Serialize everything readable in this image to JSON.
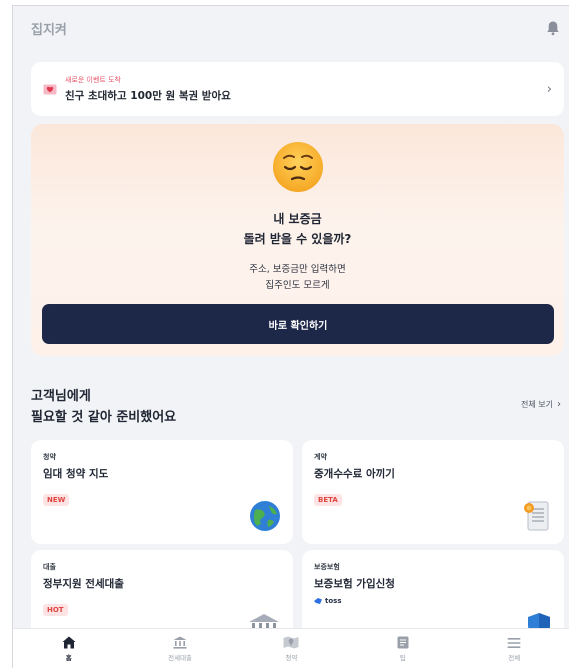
{
  "header": {
    "app_title": "집지켜",
    "icon": "bell-icon"
  },
  "event_banner": {
    "kicker": "새로운 이벤트 도착",
    "title": "친구 초대하고 100만 원 복권 받아요",
    "icon": "heart-envelope-icon"
  },
  "hero": {
    "title_line1": "내 보증금",
    "title_line2": "돌려 받을 수 있을까?",
    "sub_line1": "주소, 보증금만 입력하면",
    "sub_line2": "집주인도 모르게",
    "button_label": "바로 확인하기"
  },
  "recommend": {
    "title_line1": "고객님에게",
    "title_line2": "필요할 것 같아 준비했어요",
    "see_all_label": "전체 보기"
  },
  "cards": [
    {
      "category": "청약",
      "title": "임대 청약 지도",
      "badge": "NEW",
      "icon": "globe-icon"
    },
    {
      "category": "계약",
      "title": "중개수수료 아끼기",
      "badge": "BETA",
      "icon": "document-seal-icon"
    },
    {
      "category": "대출",
      "title": "정부지원 전세대출",
      "badge": "HOT",
      "icon": "bank-icon"
    },
    {
      "category": "보증보험",
      "title": "보증보험 가입신청",
      "badge": "toss",
      "icon": "shield-icon"
    }
  ],
  "tabbar": {
    "items": [
      {
        "label": "홈",
        "icon": "home-icon",
        "active": true
      },
      {
        "label": "전세대출",
        "icon": "bank-icon",
        "active": false
      },
      {
        "label": "청약",
        "icon": "map-icon",
        "active": false
      },
      {
        "label": "팁",
        "icon": "book-icon",
        "active": false
      },
      {
        "label": "전체",
        "icon": "menu-icon",
        "active": false
      }
    ]
  },
  "colors": {
    "accent_navy": "#1d2748",
    "badge_red": "#e0453f",
    "kicker_red": "#e8556a"
  }
}
